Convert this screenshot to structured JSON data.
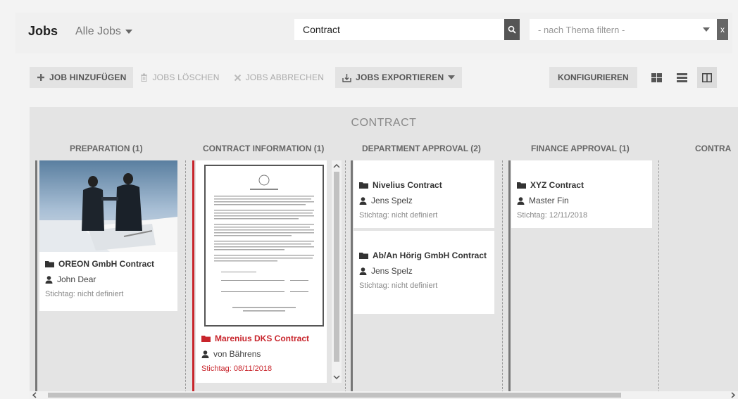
{
  "header": {
    "title": "Jobs",
    "view_select": "Alle Jobs",
    "search_value": "Contract",
    "filter_placeholder": "- nach Thema filtern -",
    "filter_clear": "x"
  },
  "toolbar": {
    "add": "JOB HINZUFÜGEN",
    "delete": "JOBS LÖSCHEN",
    "cancel": "JOBS ABBRECHEN",
    "export": "JOBS EXPORTIEREN",
    "configure": "KONFIGURIEREN"
  },
  "board": {
    "title": "CONTRACT",
    "columns": [
      {
        "label": "PREPARATION (1)"
      },
      {
        "label": "CONTRACT INFORMATION (1)"
      },
      {
        "label": "DEPARTMENT APPROVAL (2)"
      },
      {
        "label": "FINANCE APPROVAL (1)"
      },
      {
        "label": "CONTRA"
      }
    ],
    "cards": {
      "oreon": {
        "title": "OREON GmbH Contract",
        "user": "John Dear",
        "date": "Stichtag: nicht definiert"
      },
      "marenius": {
        "title": "Marenius DKS Contract",
        "user": "von Bährens",
        "date": "Stichtag: 08/11/2018"
      },
      "nivelius": {
        "title": "Nivelius Contract",
        "user": "Jens Spelz",
        "date": "Stichtag: nicht definiert"
      },
      "abhorig": {
        "title": "Ab/An Hörig GmbH Contract",
        "user": "Jens Spelz",
        "date": "Stichtag: nicht definiert"
      },
      "xyz": {
        "title": "XYZ Contract",
        "user": "Master Fin",
        "date": "Stichtag: 12/11/2018"
      }
    }
  },
  "colors": {
    "accent_red": "#c8252c",
    "lane_gray": "#777777"
  }
}
